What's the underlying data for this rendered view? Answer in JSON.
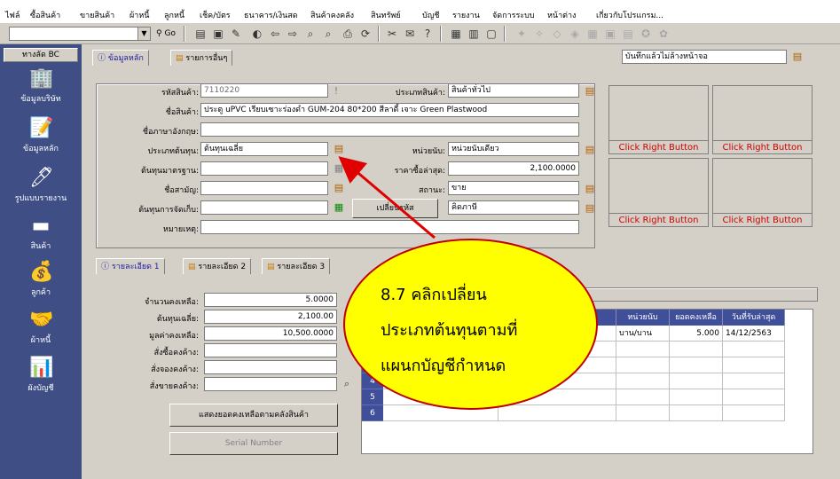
{
  "menu": [
    "ไฟล์",
    "ซื้อสินค้า",
    "ขายสินค้า",
    "ผ้าหนี้",
    "ลูกหนี้",
    "เช็ค/บัตร",
    "ธนาคาร/เงินสด",
    "สินค้าคงคลัง",
    "สินทรัพย์",
    "บัญชี",
    "รายงาน",
    "จัดการระบบ",
    "หน้าต่าง",
    "เกี่ยวกับโปรแกรม..."
  ],
  "toolbar": {
    "go_label": "Go",
    "combo_value": ""
  },
  "sidebar": {
    "header": "ทางลัด BC",
    "items": [
      {
        "label": "ข้อมูลบริษัท",
        "icon": "office-building-icon"
      },
      {
        "label": "ข้อมูลหลัก",
        "icon": "master-data-icon"
      },
      {
        "label": "รูปแบบรายงาน",
        "icon": "report-format-icon"
      },
      {
        "label": "สินค้า",
        "icon": "product-chip-icon"
      },
      {
        "label": "ลูกค้า",
        "icon": "customer-money-icon"
      },
      {
        "label": "ผ้าหนี้",
        "icon": "creditor-icon"
      },
      {
        "label": "ผังบัญชี",
        "icon": "chart-of-accounts-icon"
      }
    ]
  },
  "tabs": {
    "main": "ข้อมูลหลัก",
    "other": "รายการอื่นๆ"
  },
  "top_option": "บันทึกแล้วไม่ล้างหน้าจอ",
  "form": {
    "code_label": "รหัสสินค้า:",
    "code_value": "7110220",
    "type_label": "ประเภทสินค้า:",
    "type_value": "สินค้าทั่วไป",
    "name_label": "ชื่อสินค้า:",
    "name_value": "ประตู uPVC เรียบเซาะร่องดำ GUM-204 80*200 สีลาดี้ เจาะ Green Plastwood",
    "eng_label": "ชื่อภาษาอังกฤษ:",
    "eng_value": "",
    "costtype_label": "ประเภทต้นทุน:",
    "costtype_value": "ต้นทุนเฉลี่ย",
    "unit_label": "หน่วยนับ:",
    "unit_value": "หน่วยนับเดียว",
    "stdcost_label": "ต้นทุนมาตรฐาน:",
    "stdcost_value": "",
    "lastprice_label": "ราคาซื้อล่าสุด:",
    "lastprice_value": "2,100.0000",
    "alias_label": "ชื่อสามัญ:",
    "alias_value": "",
    "status_label": "สถานะ:",
    "status_value": "ขาย",
    "storecost_label": "ต้นทุนการจัดเก็บ:",
    "storecost_value": "",
    "change_btn": "เปลี่ยนรหัส",
    "category_value": "คิดภาษี",
    "note_label": "หมายเหตุ:",
    "note_value": ""
  },
  "image_boxes": [
    "Click Right Button",
    "Click Right Button",
    "Click Right Button",
    "Click Right Button"
  ],
  "subtabs": [
    "รายละเอียด 1",
    "รายละเอียด 2",
    "รายละเอียด 3"
  ],
  "details": {
    "qty_label": "จำนวนคงเหลือ:",
    "qty_value": "5.0000",
    "avgcost_label": "ต้นทุนเฉลี่ย:",
    "avgcost_value": "2,100.00",
    "value_label": "มูลค่าคงเหลือ:",
    "value_value": "10,500.0000",
    "po_label": "สั่งซื้อคงค้าง:",
    "po_value": "",
    "reserve_label": "สั่งจองคงค้าง:",
    "reserve_value": "",
    "so_label": "สั่งขายคงค้าง:",
    "so_value": "",
    "show_stock_btn": "แสดงยอดคงเหลือตามคลังสินค้า",
    "serial_btn": "Serial Number"
  },
  "grid": {
    "headers": [
      "หน่วยนับ",
      "ยอดคงเหลือ",
      "วันที่รับล่าสุด"
    ],
    "rows": [
      {
        "n": "1",
        "unit": "บาน/บาน",
        "qty": "5.000",
        "date": "14/12/2563"
      },
      {
        "n": "2",
        "unit": "",
        "qty": "",
        "date": ""
      },
      {
        "n": "3",
        "unit": "",
        "qty": "",
        "date": ""
      },
      {
        "n": "4",
        "unit": "",
        "qty": "",
        "date": ""
      },
      {
        "n": "5",
        "unit": "",
        "qty": "",
        "date": ""
      },
      {
        "n": "6",
        "unit": "",
        "qty": "",
        "date": ""
      }
    ]
  },
  "callout": {
    "line1": "8.7 คลิกเปลี่ยน",
    "line2": "ประเภทต้นทุนตามที่",
    "line3": "แผนกบัญชีกำหนด",
    "fill": "#ffff00",
    "border": "#c00000",
    "arrow": "#e00000"
  }
}
